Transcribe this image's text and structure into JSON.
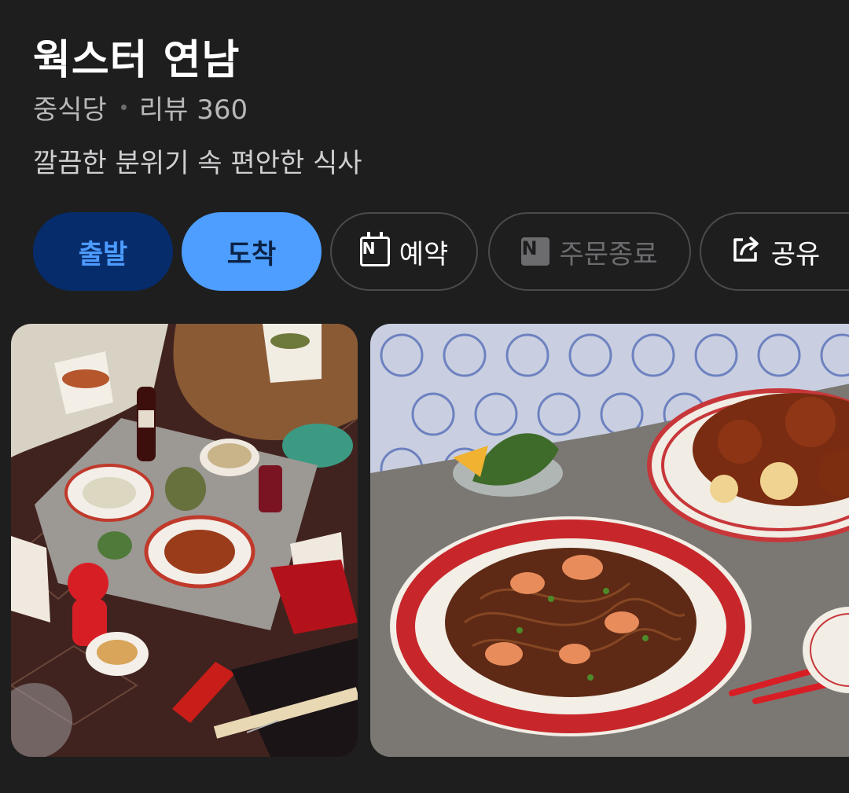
{
  "place": {
    "name": "웍스터 연남",
    "category": "중식당",
    "review_label": "리뷰 360",
    "description": "깔끔한 분위기 속 편안한 식사"
  },
  "actions": {
    "depart": "출발",
    "arrive": "도착",
    "reserve": "예약",
    "order_closed": "주문종료",
    "share": "공유"
  },
  "icons": {
    "reserve": "naver-calendar-icon",
    "order": "naver-n-icon",
    "share": "share-icon"
  },
  "colors": {
    "background": "#1e1e1f",
    "depart_bg": "#062c6b",
    "depart_text": "#4d9bff",
    "arrive_bg": "#4d9eff",
    "arrive_text": "#0c2245"
  },
  "photos": [
    {
      "description_name": "food-spread-photo"
    },
    {
      "description_name": "noodle-dish-photo"
    }
  ]
}
